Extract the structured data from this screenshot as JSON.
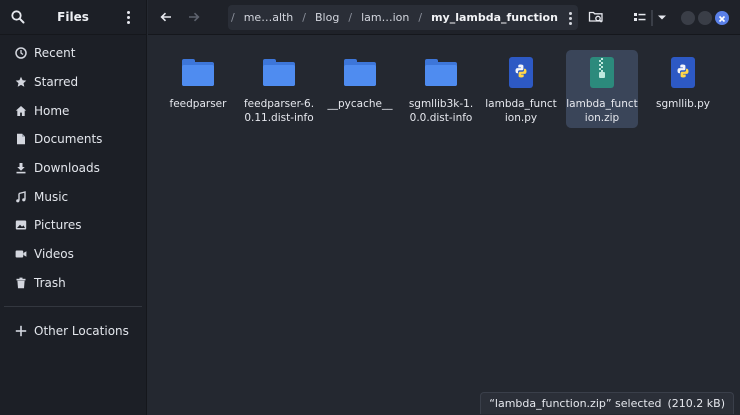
{
  "sidebar": {
    "title": "Files",
    "places": [
      {
        "label": "Recent",
        "icon": "clock-icon"
      },
      {
        "label": "Starred",
        "icon": "star-icon"
      },
      {
        "label": "Home",
        "icon": "home-icon"
      },
      {
        "label": "Documents",
        "icon": "document-icon"
      },
      {
        "label": "Downloads",
        "icon": "download-icon"
      },
      {
        "label": "Music",
        "icon": "music-icon"
      },
      {
        "label": "Pictures",
        "icon": "picture-icon"
      },
      {
        "label": "Videos",
        "icon": "video-icon"
      },
      {
        "label": "Trash",
        "icon": "trash-icon"
      }
    ],
    "other": {
      "label": "Other Locations",
      "icon": "plus-icon"
    }
  },
  "path": {
    "crumbs": [
      "me…alth",
      "Blog",
      "lam…ion",
      "my_lambda_function"
    ]
  },
  "files": [
    {
      "name": "feedparser",
      "kind": "folder"
    },
    {
      "name": "feedparser-6.0.11.dist-info",
      "kind": "folder"
    },
    {
      "name": "__pycache__",
      "kind": "folder"
    },
    {
      "name": "sgmllib3k-1.0.0.dist-info",
      "kind": "folder"
    },
    {
      "name": "lambda_function.py",
      "kind": "python"
    },
    {
      "name": "lambda_function.zip",
      "kind": "zip",
      "selected": true
    },
    {
      "name": "sgmllib.py",
      "kind": "python"
    }
  ],
  "status": {
    "selected": "“lambda_function.zip” selected",
    "size": "(210.2 kB)"
  },
  "colors": {
    "accent": "#4f8cf0",
    "selection": "#3a4559",
    "sidebar_bg": "#1c1f26",
    "main_bg": "#242830"
  }
}
